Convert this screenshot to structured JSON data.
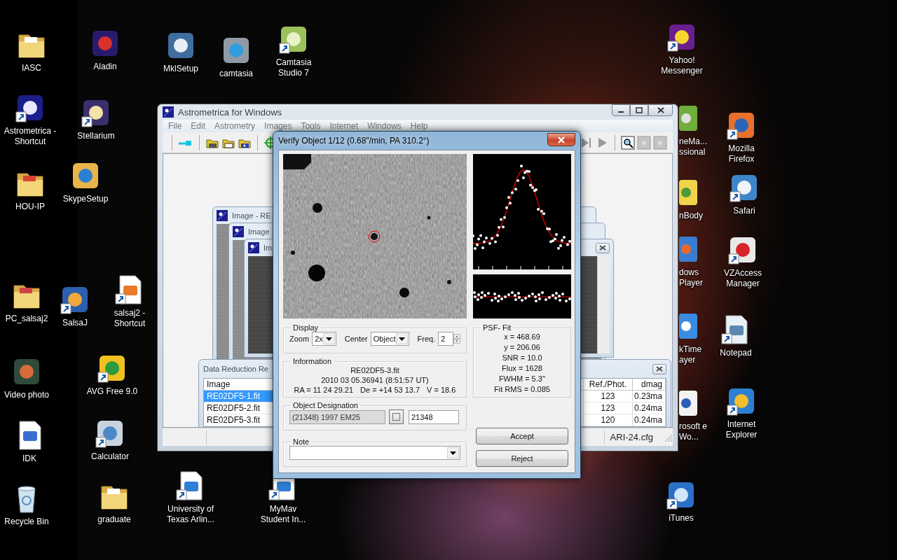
{
  "desktop": {
    "icons": [
      {
        "label": "IASC",
        "kind": "folder",
        "shortcut": false
      },
      {
        "label": "Aladin",
        "kind": "app",
        "shortcut": false
      },
      {
        "label": "MklSetup",
        "kind": "app",
        "shortcut": false
      },
      {
        "label": "camtasia",
        "kind": "app",
        "shortcut": false
      },
      {
        "label": "Camtasia Studio 7",
        "kind": "app",
        "shortcut": true
      },
      {
        "label": "Yahoo! Messenger",
        "kind": "app",
        "shortcut": true
      },
      {
        "label": "Astrometrica - Shortcut",
        "kind": "app",
        "shortcut": true
      },
      {
        "label": "Stellarium",
        "kind": "app",
        "shortcut": true
      },
      {
        "label": "HOU-IP",
        "kind": "folder",
        "shortcut": false
      },
      {
        "label": "SkypeSetup",
        "kind": "app",
        "shortcut": false
      },
      {
        "label": "Mozilla Firefox",
        "kind": "app",
        "shortcut": true
      },
      {
        "label": "Safari",
        "kind": "app",
        "shortcut": true
      },
      {
        "label": "VZAccess Manager",
        "kind": "app",
        "shortcut": true
      },
      {
        "label": "Notepad",
        "kind": "document",
        "shortcut": true
      },
      {
        "label": "Internet Explorer",
        "kind": "app",
        "shortcut": true
      },
      {
        "label": "iTunes",
        "kind": "app",
        "shortcut": true
      },
      {
        "label": "PC_salsaj2",
        "kind": "folder",
        "shortcut": false
      },
      {
        "label": "SalsaJ",
        "kind": "app",
        "shortcut": true
      },
      {
        "label": "salsaj2 - Shortcut",
        "kind": "document",
        "shortcut": true
      },
      {
        "label": "Video photo",
        "kind": "app",
        "shortcut": false
      },
      {
        "label": "AVG Free 9.0",
        "kind": "app",
        "shortcut": true
      },
      {
        "label": "IDK",
        "kind": "document",
        "shortcut": false
      },
      {
        "label": "Calculator",
        "kind": "app",
        "shortcut": true
      },
      {
        "label": "Recycle Bin",
        "kind": "bin",
        "shortcut": false
      },
      {
        "label": "graduate",
        "kind": "folder",
        "shortcut": false
      },
      {
        "label": "University of Texas Arlin...",
        "kind": "document",
        "shortcut": true
      },
      {
        "label": "MyMav Student In...",
        "kind": "document",
        "shortcut": true
      },
      {
        "label": "neMa... ssional",
        "kind": "partial",
        "shortcut": false
      },
      {
        "label": "nBody",
        "kind": "partial",
        "shortcut": false
      },
      {
        "label": "dows Player",
        "kind": "partial",
        "shortcut": false
      },
      {
        "label": "kTime ayer",
        "kind": "partial",
        "shortcut": false
      },
      {
        "label": "rosoft e Wo...",
        "kind": "partial",
        "shortcut": false
      }
    ]
  },
  "main_window": {
    "title": "Astrometrica for Windows",
    "menu": [
      "File",
      "Edit",
      "Astrometry",
      "Images",
      "Tools",
      "Internet",
      "Windows",
      "Help"
    ],
    "image_windows": [
      {
        "title": "Image - RE"
      },
      {
        "title": "Image"
      },
      {
        "title": "Im"
      }
    ],
    "data_reduction": {
      "title": "Data Reduction Re",
      "columns": [
        "Image",
        "Ref./Phot.",
        "dmag"
      ],
      "rows": [
        {
          "cells": [
            "RE02DF5-1.fit",
            "123",
            "0.23ma"
          ],
          "selected": true
        },
        {
          "cells": [
            "RE02DF5-2.fit",
            "123",
            "0.24ma"
          ],
          "selected": false
        },
        {
          "cells": [
            "RE02DF5-3.fit",
            "120",
            "0.24ma"
          ],
          "selected": false
        }
      ]
    },
    "status_text": "ARI-24.cfg"
  },
  "dialog": {
    "title": "Verify Object 1/12 (0.68\"/min, PA 310.2°)",
    "display": {
      "legend": "Display",
      "zoom_label": "Zoom",
      "zoom_value": "2x",
      "center_label": "Center",
      "center_value": "Object",
      "freq_label": "Freq.",
      "freq_value": "2"
    },
    "information": {
      "legend": "Information",
      "lines": [
        [
          "RE02DF5-3.fit"
        ],
        [
          "2010 03 05.36941 (8:51:57 UT)"
        ],
        [
          "RA = 11 24 29.21",
          "De = +14 53 13.7",
          "V = 18.6"
        ]
      ]
    },
    "designation": {
      "legend": "Object Designation",
      "name_value": "(21348) 1997 EM25",
      "name_disabled": true,
      "number_value": "21348"
    },
    "note": {
      "legend": "Note"
    },
    "psf_fit": {
      "legend": "PSF- Fit",
      "lines": [
        "x = 468.69",
        "y = 206.06",
        "SNR = 10.0",
        "Flux = 1628",
        "FWHM = 5.3''",
        "Fit RMS = 0.085"
      ]
    },
    "buttons": [
      {
        "label": "Accept"
      },
      {
        "label": "Reject"
      }
    ]
  }
}
